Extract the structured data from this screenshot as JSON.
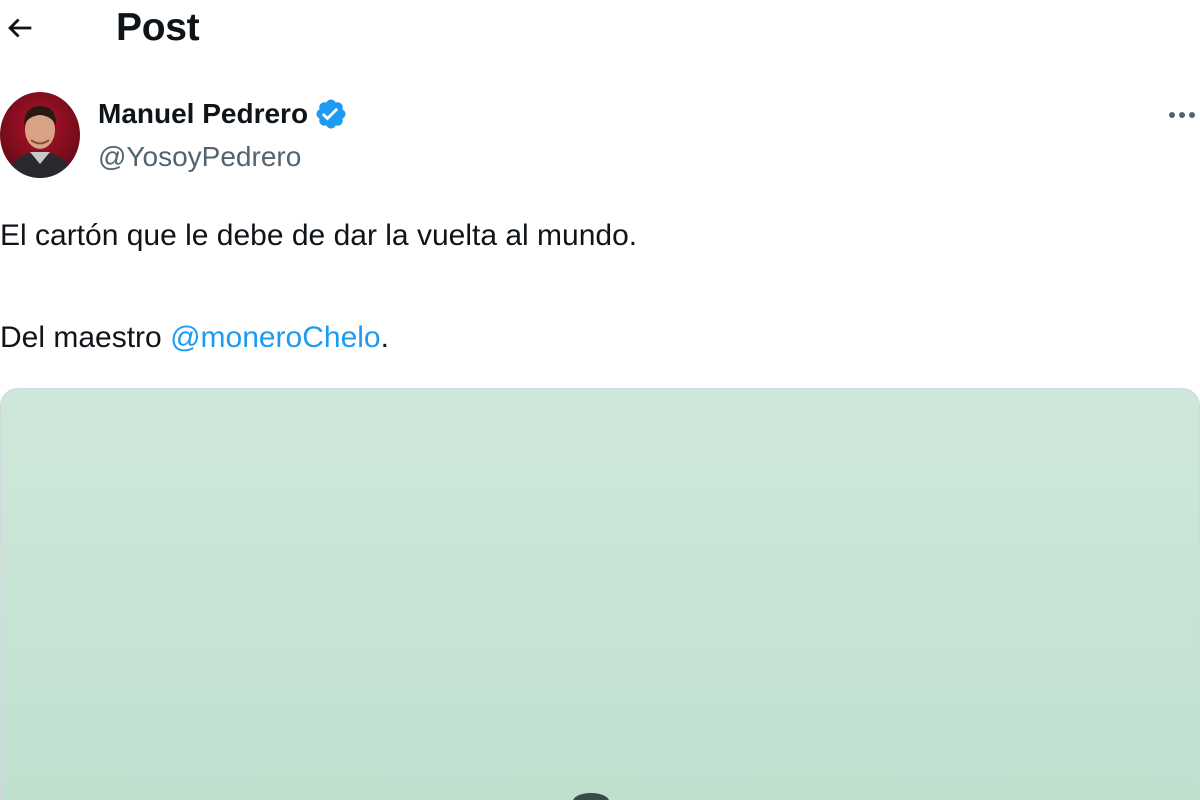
{
  "header": {
    "back_icon": "arrow-left-icon",
    "title": "Post"
  },
  "author": {
    "name": "Manuel Pedrero",
    "handle": "@YosoyPedrero",
    "verified_icon": "verified-badge-icon",
    "verified_color": "#1d9bf0"
  },
  "more_icon": "more-horizontal-icon",
  "post": {
    "line1": "El cartón que le debe de dar la vuelta al mundo.",
    "line2_prefix": "Del maestro ",
    "line2_mention": "@moneroChelo",
    "line2_suffix": "."
  },
  "colors": {
    "text": "#0f1419",
    "secondary_text": "#536471",
    "link": "#1d9bf0",
    "media_bg": "#c8e4d5"
  }
}
